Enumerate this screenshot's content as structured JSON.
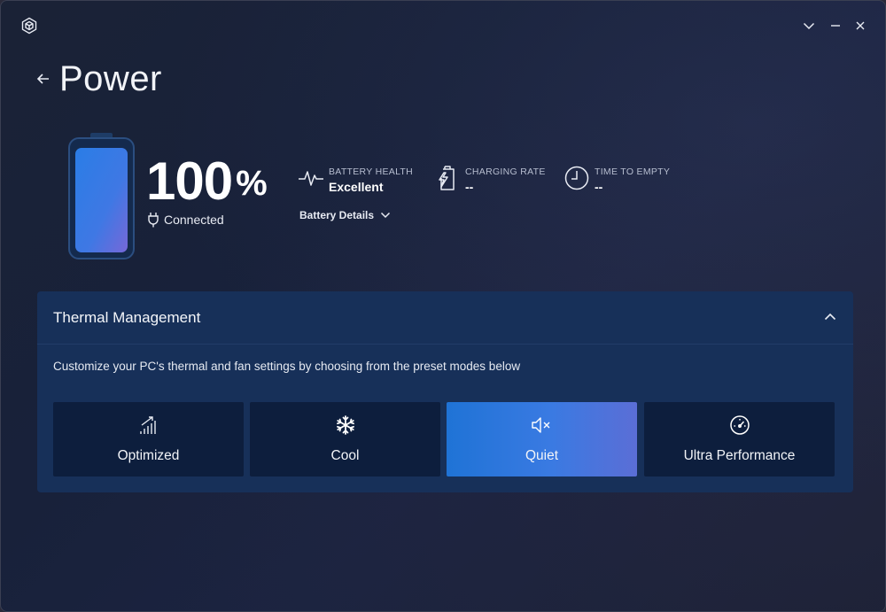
{
  "header": {
    "title": "Power"
  },
  "battery": {
    "percent": "100",
    "percent_sign": "%",
    "level": 1.0,
    "status": "Connected",
    "stats": [
      {
        "label": "BATTERY HEALTH",
        "value": "Excellent",
        "icon": "heartbeat-icon"
      },
      {
        "label": "CHARGING RATE",
        "value": "--",
        "icon": "charging-battery-icon"
      },
      {
        "label": "TIME TO EMPTY",
        "value": "--",
        "icon": "clock-icon"
      }
    ],
    "details_label": "Battery Details"
  },
  "thermal": {
    "title": "Thermal Management",
    "description": "Customize your PC's thermal and fan settings by choosing from the preset modes below",
    "selected": "Quiet",
    "modes": [
      {
        "label": "Optimized",
        "icon": "signal-bars-icon"
      },
      {
        "label": "Cool",
        "icon": "snowflake-icon"
      },
      {
        "label": "Quiet",
        "icon": "speaker-mute-icon"
      },
      {
        "label": "Ultra Performance",
        "icon": "speedometer-icon"
      }
    ]
  },
  "colors": {
    "accent_start": "#1f73d6",
    "accent_end": "#5b6ed6",
    "panel": "#173059",
    "tile": "#0d1e3d"
  }
}
